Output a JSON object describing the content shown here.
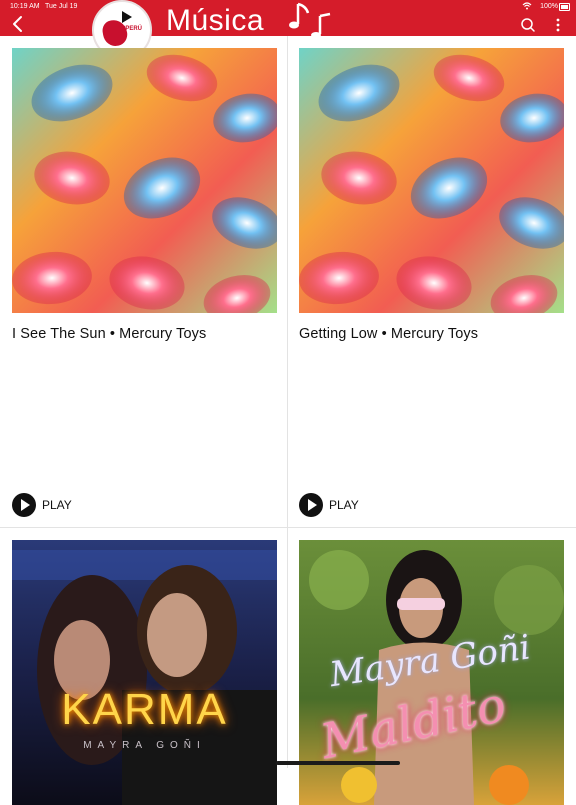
{
  "status_bar": {
    "time": "10:19 AM",
    "date": "Tue Jul 19",
    "battery": "100%"
  },
  "header": {
    "title": "Música",
    "logo_text": "APPERÚ",
    "accent_color": "#d51c2a",
    "icons": {
      "back": "chevron-left-icon",
      "search": "search-icon",
      "more": "more-vertical-icon"
    }
  },
  "songs": [
    {
      "caption": "I See The Sun • Mercury Toys",
      "play_label": "PLAY"
    },
    {
      "caption": "Getting Low • Mercury Toys",
      "play_label": "PLAY"
    },
    {
      "cover_title": "KARMA",
      "cover_artist": "MAYRA GOÑI"
    },
    {
      "cover_title": "Maldito",
      "cover_artist": "Mayra Goñi"
    }
  ]
}
